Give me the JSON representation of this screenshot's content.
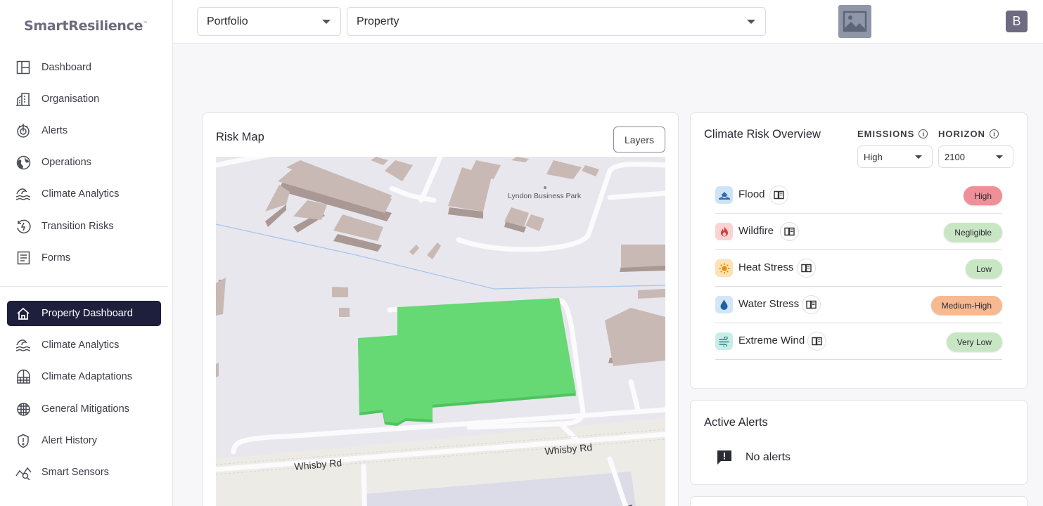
{
  "app": {
    "logo_text": "SmartResilience",
    "logo_mark": "™"
  },
  "sidebar": {
    "primary": [
      {
        "label": "Dashboard",
        "icon": "dashboard-grid-icon"
      },
      {
        "label": "Organisation",
        "icon": "building-icon"
      },
      {
        "label": "Alerts",
        "icon": "alert-signal-icon"
      },
      {
        "label": "Operations",
        "icon": "globe-icon"
      },
      {
        "label": "Climate Analytics",
        "icon": "waves-icon"
      },
      {
        "label": "Transition Risks",
        "icon": "transition-icon"
      },
      {
        "label": "Forms",
        "icon": "form-icon"
      }
    ],
    "secondary": [
      {
        "label": "Property Dashboard",
        "icon": "home-icon",
        "active": true
      },
      {
        "label": "Climate Analytics",
        "icon": "waves-icon"
      },
      {
        "label": "Climate Adaptations",
        "icon": "shelter-icon"
      },
      {
        "label": "General Mitigations",
        "icon": "globe-grid-icon"
      },
      {
        "label": "Alert History",
        "icon": "shield-alert-icon"
      },
      {
        "label": "Smart Sensors",
        "icon": "sensor-chart-icon"
      }
    ]
  },
  "topbar": {
    "portfolio_value": "Portfolio",
    "property_value": "Property",
    "avatar_initial": "B"
  },
  "risk_map": {
    "title": "Risk Map",
    "layers_label": "Layers",
    "map_labels": {
      "business_park": "Lyndon Business Park",
      "road_left": "Whisby Rd",
      "road_right": "Whisby Rd",
      "road_corner": "P"
    }
  },
  "climate_risk": {
    "title": "Climate Risk Overview",
    "emissions_label": "EMISSIONS",
    "emissions_value": "High",
    "horizon_label": "HORIZON",
    "horizon_value": "2100",
    "hazards": [
      {
        "name": "Flood",
        "level": "High",
        "icon": "flood-icon",
        "icon_bg": "#cfe3f7",
        "badge_color": "#ef8f98"
      },
      {
        "name": "Wildfire",
        "level": "Negligible",
        "icon": "fire-icon",
        "icon_bg": "#fbd3d3",
        "badge_color": "#c8e6c4"
      },
      {
        "name": "Heat Stress",
        "level": "Low",
        "icon": "sun-icon",
        "icon_bg": "#fde2b5",
        "badge_color": "#c8e6c4"
      },
      {
        "name": "Water Stress",
        "level": "Medium-High",
        "icon": "water-drop-icon",
        "icon_bg": "#d2e6f8",
        "badge_color": "#f6b991"
      },
      {
        "name": "Extreme Wind",
        "level": "Very Low",
        "icon": "wind-icon",
        "icon_bg": "#c9ece6",
        "badge_color": "#c8e6c4"
      }
    ]
  },
  "active_alerts": {
    "title": "Active Alerts",
    "message": "No alerts"
  },
  "colors": {
    "sidebar_active": "#1d1f3c",
    "property_highlight": "#66d874",
    "building": "#c9b9b4"
  }
}
